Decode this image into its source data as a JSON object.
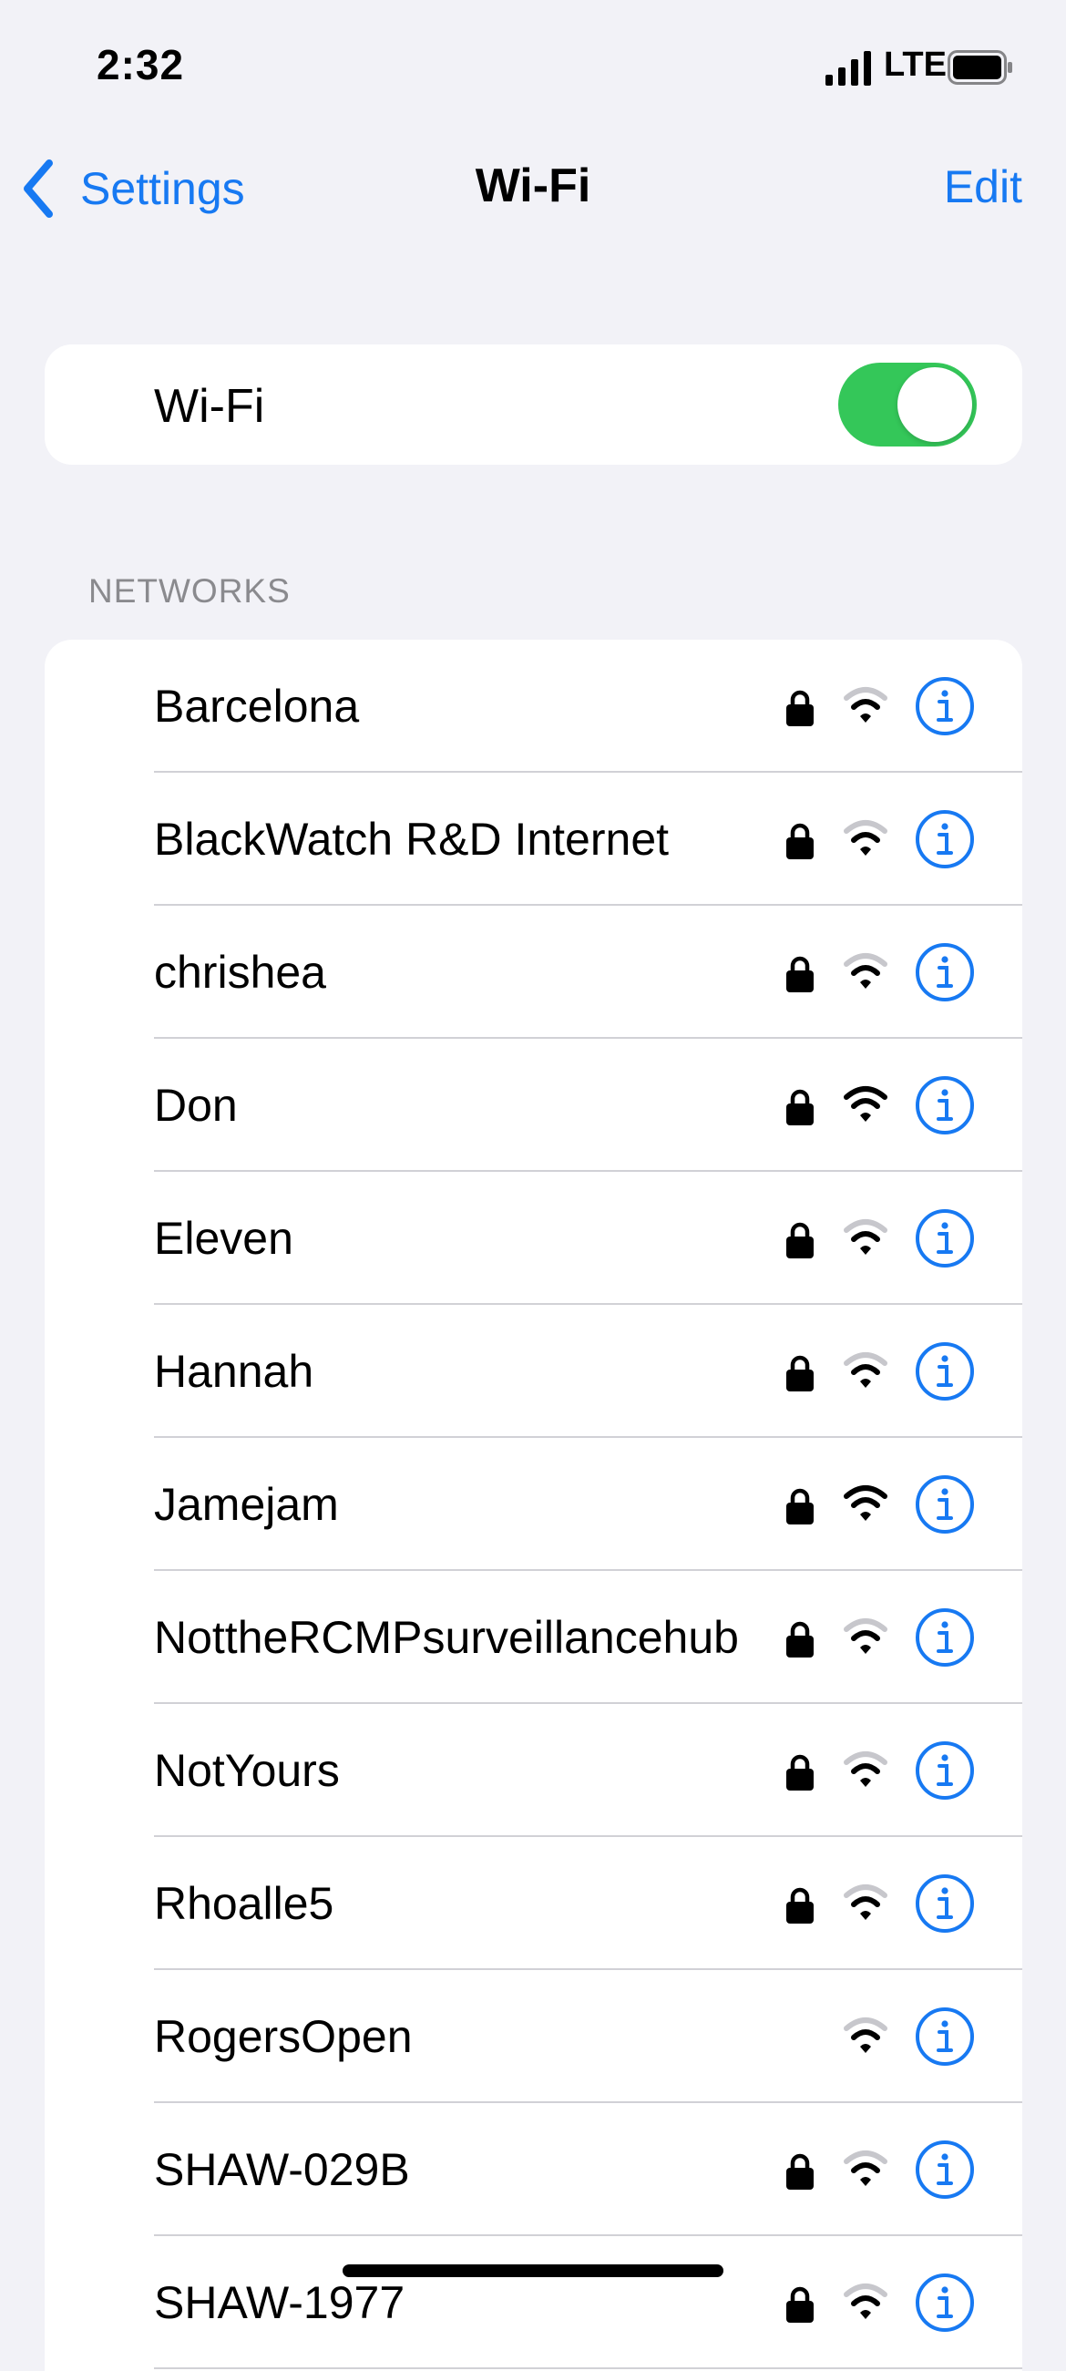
{
  "status_bar": {
    "time": "2:32",
    "carrier": "LTE"
  },
  "nav": {
    "back_label": "Settings",
    "title": "Wi-Fi",
    "edit_label": "Edit"
  },
  "wifi_toggle": {
    "label": "Wi-Fi",
    "on": true
  },
  "networks": {
    "header": "NETWORKS",
    "items": [
      {
        "name": "Barcelona",
        "locked": true,
        "signal_bars": 2
      },
      {
        "name": "BlackWatch R&D Internet",
        "locked": true,
        "signal_bars": 2
      },
      {
        "name": "chrishea",
        "locked": true,
        "signal_bars": 2
      },
      {
        "name": "Don",
        "locked": true,
        "signal_bars": 3
      },
      {
        "name": "Eleven",
        "locked": true,
        "signal_bars": 2
      },
      {
        "name": "Hannah",
        "locked": true,
        "signal_bars": 2
      },
      {
        "name": "Jamejam",
        "locked": true,
        "signal_bars": 3
      },
      {
        "name": "NottheRCMPsurveillancehub",
        "locked": true,
        "signal_bars": 2
      },
      {
        "name": "NotYours",
        "locked": true,
        "signal_bars": 2
      },
      {
        "name": "Rhoalle5",
        "locked": true,
        "signal_bars": 2
      },
      {
        "name": "RogersOpen",
        "locked": false,
        "signal_bars": 2
      },
      {
        "name": "SHAW-029B",
        "locked": true,
        "signal_bars": 2
      },
      {
        "name": "SHAW-1977",
        "locked": true,
        "signal_bars": 2
      }
    ]
  },
  "colors": {
    "accent": "#1779F2",
    "toggle_on": "#34C759",
    "background": "#F2F2F7"
  }
}
